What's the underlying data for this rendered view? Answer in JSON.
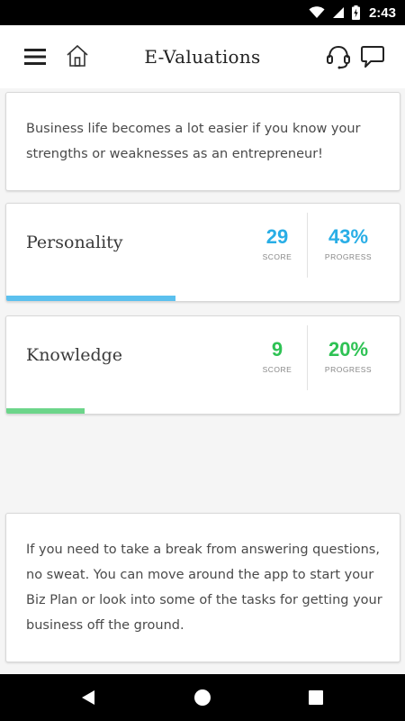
{
  "status_bar": {
    "time": "2:43",
    "icons": [
      "wifi-icon",
      "signal-icon",
      "battery-charging-icon"
    ]
  },
  "header": {
    "title": "E-Valuations",
    "left_icons": [
      "menu-icon",
      "home-icon"
    ],
    "right_icons": [
      "headset-icon",
      "chat-icon"
    ]
  },
  "intro": {
    "text": "Business life becomes a lot easier if you know your strengths or weaknesses as an entrepreneur!"
  },
  "evaluations": [
    {
      "label": "Personality",
      "score": "29",
      "score_caption": "SCORE",
      "progress": "43%",
      "progress_caption": "PROGRESS",
      "progress_value": 0.43,
      "color": "#29aee6",
      "bar_color": "#5bc0ee"
    },
    {
      "label": "Knowledge",
      "score": "9",
      "score_caption": "SCORE",
      "progress": "20%",
      "progress_caption": "PROGRESS",
      "progress_value": 0.2,
      "color": "#2ec254",
      "bar_color": "#6cd58a"
    }
  ],
  "note": {
    "text": "If you need to take a break from answering questions, no sweat. You can move around the app to start your Biz Plan or look into some of the tasks for getting  your business off the ground."
  },
  "nav_bar": {
    "icons": [
      "back-icon",
      "home-circle-icon",
      "recents-icon"
    ]
  }
}
